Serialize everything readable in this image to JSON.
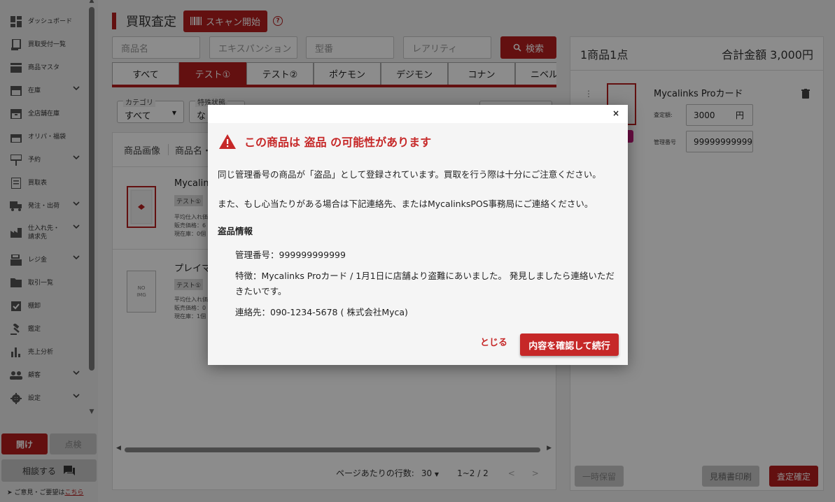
{
  "sidebar": {
    "items": [
      {
        "label": "ダッシュボード",
        "icon": "dashboard-icon"
      },
      {
        "label": "買取受付一覧",
        "icon": "receipt-icon"
      },
      {
        "label": "商品マスタ",
        "icon": "store-icon"
      },
      {
        "label": "在庫",
        "icon": "inventory-icon",
        "expandable": true
      },
      {
        "label": "全店舗在庫",
        "icon": "archive-icon"
      },
      {
        "label": "オリパ・福袋",
        "icon": "gift-icon"
      },
      {
        "label": "予約",
        "icon": "desk-icon",
        "expandable": true
      },
      {
        "label": "買取表",
        "icon": "list-icon"
      },
      {
        "label": "発注・出荷",
        "icon": "truck-icon",
        "expandable": true
      },
      {
        "label": "仕入れ先・\n請求先",
        "icon": "factory-icon",
        "expandable": true
      },
      {
        "label": "レジ金",
        "icon": "register-icon",
        "expandable": true
      },
      {
        "label": "取引一覧",
        "icon": "folder-icon"
      },
      {
        "label": "棚卸",
        "icon": "checkbox-icon"
      },
      {
        "label": "鑑定",
        "icon": "gavel-icon"
      },
      {
        "label": "売上分析",
        "icon": "bar-chart-icon"
      },
      {
        "label": "顧客",
        "icon": "people-icon",
        "expandable": true
      },
      {
        "label": "設定",
        "icon": "gear-icon",
        "expandable": true
      }
    ],
    "open_label": "開け",
    "check_label": "点検",
    "consult_label": "相談する",
    "feedback_prefix": "ご意見・ご要望は",
    "feedback_link": "こちら"
  },
  "header": {
    "title": "買取査定",
    "scan_label": "スキャン開始",
    "help": "?"
  },
  "search": {
    "name_placeholder": "商品名",
    "expansion_placeholder": "エキスパンション",
    "model_placeholder": "型番",
    "rarity_placeholder": "レアリティ",
    "search_label": "検索"
  },
  "tabs": [
    "すべて",
    "テスト①",
    "テスト②",
    "ポケモン",
    "デジモン",
    "コナン",
    "ニベルア"
  ],
  "filters": {
    "category_label": "カテゴリ",
    "category_value": "すべて",
    "status_label": "特殊状態",
    "status_value": "なし"
  },
  "table": {
    "headers": [
      "商品画像",
      "商品名・"
    ],
    "rows": [
      {
        "name": "Mycalinks",
        "tag": "テスト①",
        "meta": [
          "平均仕入れ価",
          "販売価格：6",
          "現在庫：0個"
        ]
      },
      {
        "name": "プレイマ",
        "tag": "テスト①",
        "meta": [
          "平均仕入れ価",
          "販売価格：0",
          "現在庫：1個"
        ],
        "noimg": "NO\nIMG"
      }
    ]
  },
  "pager": {
    "rows_label": "ページあたりの行数:",
    "rows_value": "30",
    "range": "1~2 / 2"
  },
  "cart": {
    "count_label": "1商品1点",
    "total_label": "合計金額 3,000円",
    "item": {
      "name": "Mycalinks Proカード",
      "price_label": "査定額:",
      "price_value": "3000",
      "price_unit": "円",
      "serial_label": "管理番号",
      "serial_value": "999999999999"
    },
    "hold_label": "一時保留",
    "estimate_label": "見積書印刷",
    "confirm_label": "査定確定"
  },
  "modal": {
    "close": "×",
    "title": "この商品は 盗品 の可能性があります",
    "text1": "同じ管理番号の商品が「盗品」として登録されています。買取を行う際は十分にご注意ください。",
    "text2": "また、もし心当たりがある場合は下記連絡先、またはMycalinksPOS事務局にご連絡ください。",
    "section": "盗品情報",
    "serial": "管理番号：999999999999",
    "feature": "特徴：Mycalinks Proカード / 1月1日に店舗より盗難にあいました。 発見しましたら連絡いただきたいです。",
    "contact": "連絡先：090-1234-5678 ( 株式会社Myca)",
    "cancel_label": "とじる",
    "ok_label": "内容を確認して続行"
  },
  "colors": {
    "accent": "#b41e1e",
    "warning": "#c62828"
  }
}
